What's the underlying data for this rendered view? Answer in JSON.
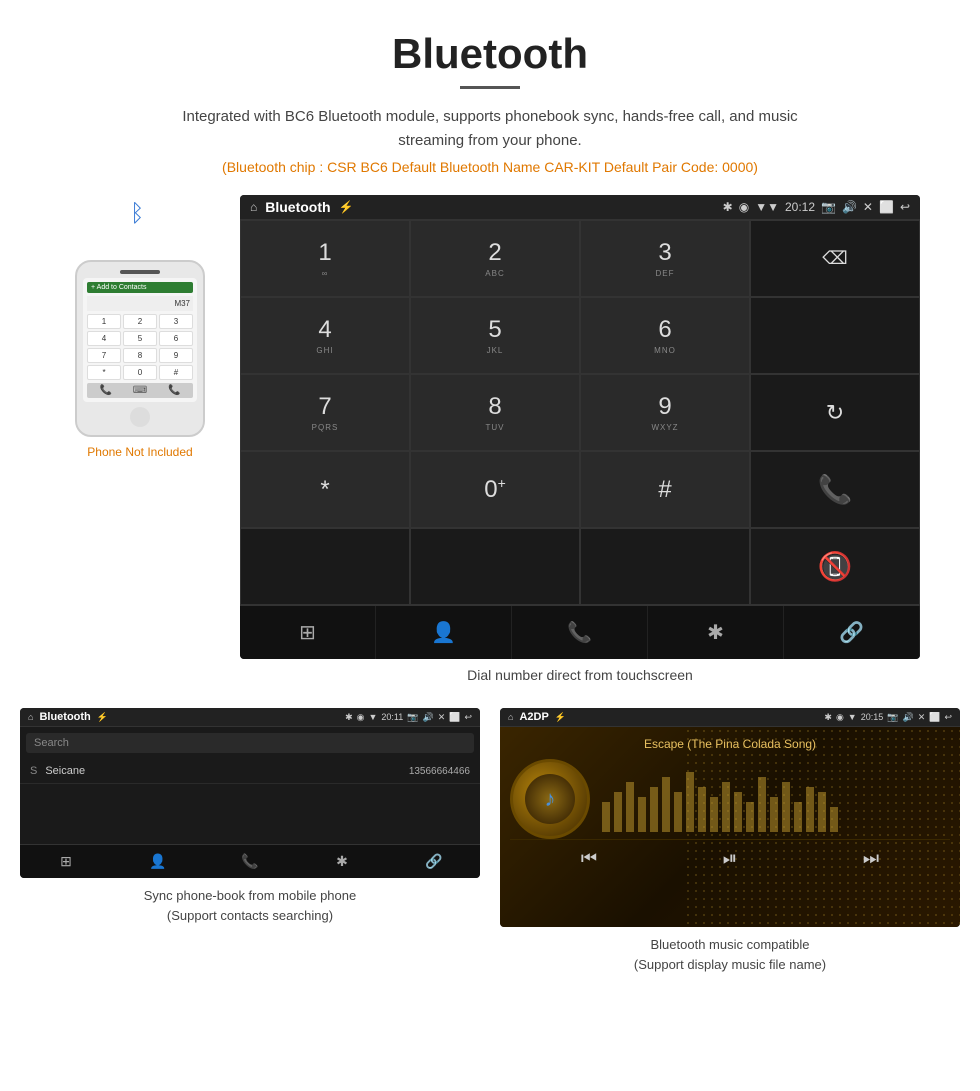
{
  "header": {
    "title": "Bluetooth",
    "description": "Integrated with BC6 Bluetooth module, supports phonebook sync, hands-free call, and music streaming from your phone.",
    "specs": "(Bluetooth chip : CSR BC6    Default Bluetooth Name CAR-KIT    Default Pair Code: 0000)"
  },
  "main_screen": {
    "statusbar": {
      "home_icon": "⌂",
      "title": "Bluetooth",
      "usb_icon": "⚡",
      "bluetooth_icon": "✱",
      "location_icon": "◉",
      "signal_icon": "▼",
      "time": "20:12",
      "camera_icon": "📷",
      "volume_icon": "🔊",
      "close_icon": "✕",
      "window_icon": "⬜",
      "back_icon": "↩"
    },
    "dialpad": [
      {
        "number": "1",
        "sub": "∞"
      },
      {
        "number": "2",
        "sub": "ABC"
      },
      {
        "number": "3",
        "sub": "DEF"
      },
      {
        "action": "backspace"
      },
      {
        "number": "4",
        "sub": "GHI"
      },
      {
        "number": "5",
        "sub": "JKL"
      },
      {
        "number": "6",
        "sub": "MNO"
      },
      {
        "action": "empty"
      },
      {
        "number": "7",
        "sub": "PQRS"
      },
      {
        "number": "8",
        "sub": "TUV"
      },
      {
        "number": "9",
        "sub": "WXYZ"
      },
      {
        "action": "refresh"
      },
      {
        "number": "*",
        "sub": ""
      },
      {
        "number": "0",
        "sub": "+"
      },
      {
        "number": "#",
        "sub": ""
      },
      {
        "action": "call_green"
      },
      {
        "action": "empty"
      },
      {
        "action": "empty"
      },
      {
        "action": "empty"
      },
      {
        "action": "call_red"
      }
    ],
    "bottom_nav": [
      "⊞",
      "👤",
      "📞",
      "✱",
      "🔗"
    ],
    "caption": "Dial number direct from touchscreen"
  },
  "phone": {
    "not_included": "Phone Not Included"
  },
  "phonebook_screen": {
    "statusbar_title": "Bluetooth",
    "time": "20:11",
    "search_placeholder": "Search",
    "contacts": [
      {
        "letter": "S",
        "name": "Seicane",
        "number": "13566664466"
      }
    ],
    "caption_line1": "Sync phone-book from mobile phone",
    "caption_line2": "(Support contacts searching)"
  },
  "music_screen": {
    "statusbar_title": "A2DP",
    "time": "20:15",
    "song_title": "Escape (The Pina Colada Song)",
    "caption_line1": "Bluetooth music compatible",
    "caption_line2": "(Support display music file name)"
  }
}
